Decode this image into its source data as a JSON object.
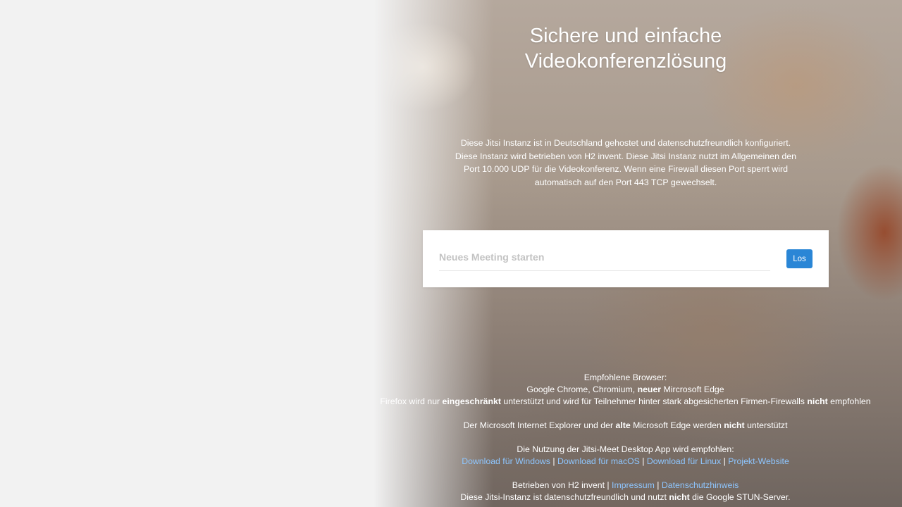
{
  "hero": {
    "title_line1": "Sichere und einfache",
    "title_line2": "Videokonferenzlösung"
  },
  "intro": {
    "text": "Diese Jitsi Instanz ist in Deutschland gehostet und datenschutzfreundlich konfiguriert. Diese Instanz wird betrieben von H2 invent. Diese Jitsi Instanz nutzt im Allgemeinen den Port 10.000 UDP für die Videokonferenz. Wenn eine Firewall diesen Port sperrt wird automatisch auf den Port 443 TCP gewechselt."
  },
  "meeting": {
    "placeholder": "Neues Meeting starten",
    "go_label": "Los",
    "accent_color": "#2a86d6"
  },
  "browsers": {
    "heading": "Empfohlene Browser:",
    "line2_pre": "Google Chrome, Chromium, ",
    "line2_bold": "neuer",
    "line2_post": " Mircrosoft Edge",
    "line3_pre": "Firefox wird nur ",
    "line3_bold1": "eingeschränkt",
    "line3_mid": " unterstützt und wird für Teilnehmer hinter stark abgesicherten Firmen-Firewalls ",
    "line3_bold2": "nicht",
    "line3_post": " empfohlen",
    "line4_pre": "Der Microsoft Internet Explorer und der ",
    "line4_bold1": "alte",
    "line4_mid": " Microsoft Edge werden ",
    "line4_bold2": "nicht",
    "line4_post": " unterstützt"
  },
  "desktop_app": {
    "heading": "Die Nutzung der Jitsi-Meet Desktop App wird empfohlen:",
    "links": [
      "Download für Windows",
      "Download für macOS",
      "Download für Linux",
      "Projekt-Website"
    ],
    "separator": " | "
  },
  "legal": {
    "operated_by": "Betrieben von H2 invent | ",
    "impressum": "Impressum",
    "separator": " | ",
    "privacy": "Datenschutzhinweis",
    "stun_pre": "Diese Jitsi-Instanz ist datenschutzfreundlich und nutzt ",
    "stun_bold": "nicht",
    "stun_post": " die Google STUN-Server."
  },
  "colors": {
    "link": "#8ec6ff",
    "panel_background": "#f2f2f2"
  }
}
